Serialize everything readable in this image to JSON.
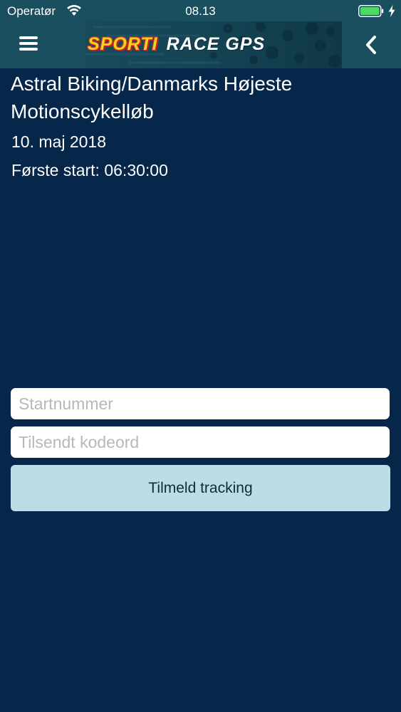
{
  "status_bar": {
    "carrier": "Operatør",
    "time": "08.13"
  },
  "nav": {
    "logo_brand": "SPORTI",
    "logo_rest": "RACE GPS",
    "colors": {
      "bar": "#1a4f60",
      "logo_yellow": "#f4d21a",
      "logo_red": "#d3302a"
    }
  },
  "event": {
    "title": "Astral Biking/Danmarks Højeste Motionscykelløb",
    "date": "10. maj 2018",
    "first_start": "Første start: 06:30:00"
  },
  "form": {
    "start_number_placeholder": "Startnummer",
    "start_number_value": "",
    "code_placeholder": "Tilsendt kodeord",
    "code_value": "",
    "submit_label": "Tilmeld tracking"
  },
  "icons": [
    "wifi-icon",
    "battery-icon",
    "charging-bolt-icon",
    "menu-icon",
    "back-chevron-icon"
  ],
  "colors": {
    "background": "#06264a",
    "button": "#bcdde5",
    "battery": "#4cd964"
  }
}
